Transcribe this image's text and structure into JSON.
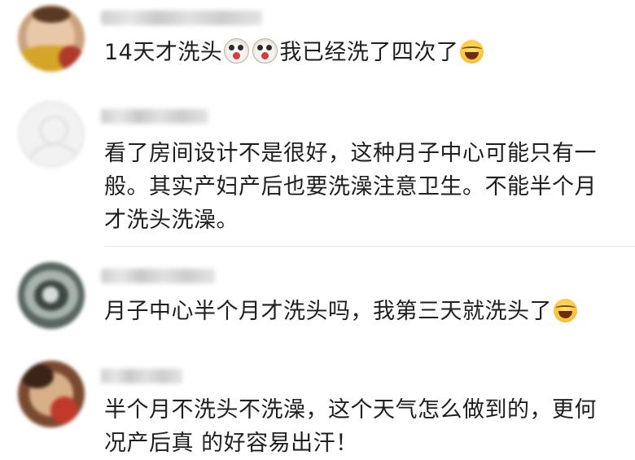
{
  "comments": [
    {
      "text_parts": [
        "14天才洗头",
        "我已经洗了四次了"
      ],
      "emojis": [
        "shocked-face-emoji",
        "shocked-face-emoji",
        "laughing-tears-emoji"
      ]
    },
    {
      "lines": [
        "看了房间设计不是很好，这种月子中心可能只有一",
        "般。其实产妇产后也要洗澡注意卫生。不能半个月",
        "才洗头洗澡。"
      ]
    },
    {
      "text_parts": [
        "月子中心半个月才洗头吗，我第三天就洗头了"
      ],
      "emojis": [
        "laughing-tears-emoji"
      ]
    },
    {
      "lines": [
        "半个月不洗头不洗澡，这个天气怎么做到的，更何",
        "况产后真 的好容易出汗！"
      ]
    }
  ],
  "colors": {
    "text": "#1e1e1e",
    "divider": "#e4e4e4",
    "blurred_name": "#d0d0d0"
  }
}
